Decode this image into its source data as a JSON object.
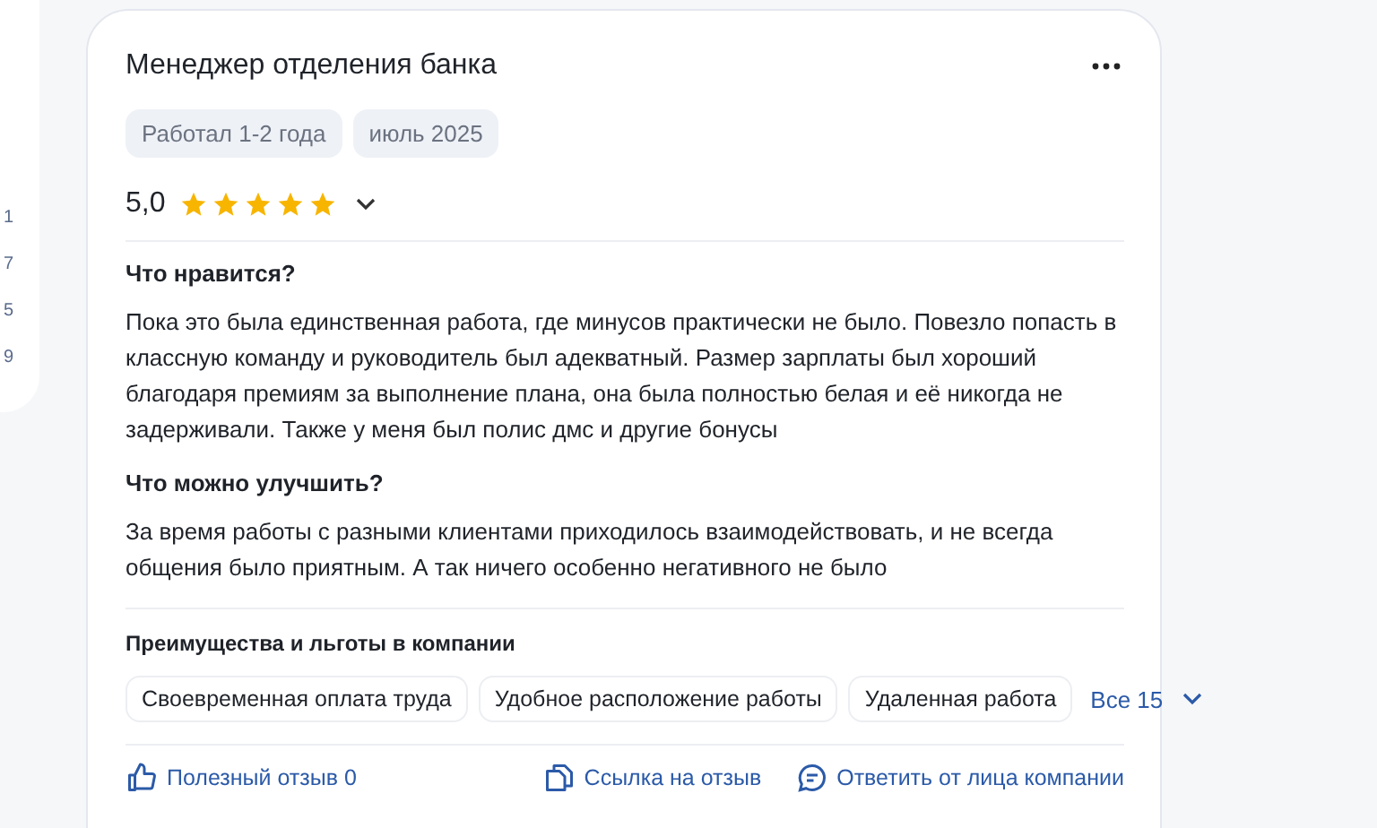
{
  "side_panel": {
    "counts": [
      "1",
      "7",
      "5",
      "9"
    ]
  },
  "review": {
    "title": "Менеджер отделения банка",
    "tags": [
      "Работал 1-2 года",
      "июль 2025"
    ],
    "rating": "5,0",
    "stars": 5,
    "sections": [
      {
        "heading": "Что нравится?",
        "text": "Пока это была единственная работа, где минусов практически не было. Повезло попасть в классную команду и руководитель был адекватный. Размер зарплаты был хороший благодаря премиям за выполнение плана, она была полностью белая и её никогда не задерживали. Также у меня был полис дмс и другие бонусы"
      },
      {
        "heading": "Что можно улучшить?",
        "text": "За время работы с разными клиентами приходилось взаимодействовать, и не всегда общения было приятным. А так ничего особенно негативного не было"
      }
    ],
    "benefits": {
      "heading": "Преимущества и льготы в компании",
      "items": [
        "Своевременная оплата труда",
        "Удобное расположение работы",
        "Удаленная работа"
      ],
      "more": "Все 15"
    },
    "actions": [
      {
        "kind": "like",
        "label": "Полезный отзыв 0"
      },
      {
        "kind": "link",
        "label": "Ссылка на отзыв"
      },
      {
        "kind": "reply",
        "label": "Ответить от лица компании"
      }
    ]
  }
}
